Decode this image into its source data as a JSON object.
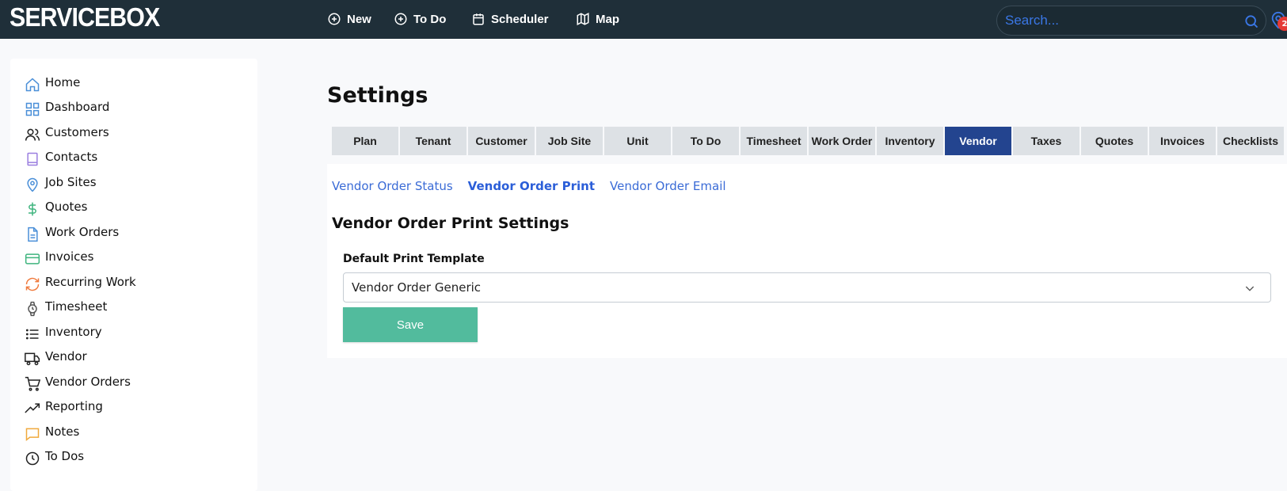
{
  "app": {
    "logo": "SERVICEBOX"
  },
  "topnav": {
    "items": [
      {
        "label": "New",
        "icon": "plus-circle-icon"
      },
      {
        "label": "To Do",
        "icon": "plus-circle-icon"
      },
      {
        "label": "Scheduler",
        "icon": "calendar-icon"
      },
      {
        "label": "Map",
        "icon": "map-icon"
      }
    ],
    "search_placeholder": "Search...",
    "notification_count": "2"
  },
  "sidebar": {
    "items": [
      {
        "label": "Home",
        "icon": "home-icon",
        "color": "#4a8fd8"
      },
      {
        "label": "Dashboard",
        "icon": "grid-icon",
        "color": "#4a8fd8"
      },
      {
        "label": "Customers",
        "icon": "users-icon",
        "color": "#222222"
      },
      {
        "label": "Contacts",
        "icon": "book-icon",
        "color": "#9b7fe0"
      },
      {
        "label": "Job Sites",
        "icon": "map-pin-icon",
        "color": "#4a8fd8"
      },
      {
        "label": "Quotes",
        "icon": "dollar-icon",
        "color": "#3fb47e"
      },
      {
        "label": "Work Orders",
        "icon": "file-icon",
        "color": "#4a8fd8"
      },
      {
        "label": "Invoices",
        "icon": "credit-card-icon",
        "color": "#3fb47e"
      },
      {
        "label": "Recurring Work",
        "icon": "refresh-icon",
        "color": "#f07a3c"
      },
      {
        "label": "Timesheet",
        "icon": "watch-icon",
        "color": "#555555"
      },
      {
        "label": "Inventory",
        "icon": "list-icon",
        "color": "#222222"
      },
      {
        "label": "Vendor",
        "icon": "truck-icon",
        "color": "#222222"
      },
      {
        "label": "Vendor Orders",
        "icon": "cart-icon",
        "color": "#222222"
      },
      {
        "label": "Reporting",
        "icon": "trending-up-icon",
        "color": "#222222"
      },
      {
        "label": "Notes",
        "icon": "message-icon",
        "color": "#f0a93c"
      },
      {
        "label": "To Dos",
        "icon": "clock-icon",
        "color": "#222222"
      }
    ]
  },
  "page": {
    "title": "Settings",
    "tabs": [
      "Plan",
      "Tenant",
      "Customer",
      "Job Site",
      "Unit",
      "To Do",
      "Timesheet",
      "Work Order",
      "Inventory",
      "Vendor",
      "Taxes",
      "Quotes",
      "Invoices",
      "Checklists"
    ],
    "active_tab": "Vendor",
    "subtabs": [
      "Vendor Order Status",
      "Vendor Order Print",
      "Vendor Order Email"
    ],
    "active_subtab": "Vendor Order Print",
    "section_title": "Vendor Order Print Settings",
    "field_label": "Default Print Template",
    "field_value": "Vendor Order Generic",
    "save_label": "Save"
  },
  "colors": {
    "topbar": "#1f2f39",
    "active_tab": "#23448f",
    "save_button": "#52bb9d",
    "link": "#3a6bd6"
  }
}
